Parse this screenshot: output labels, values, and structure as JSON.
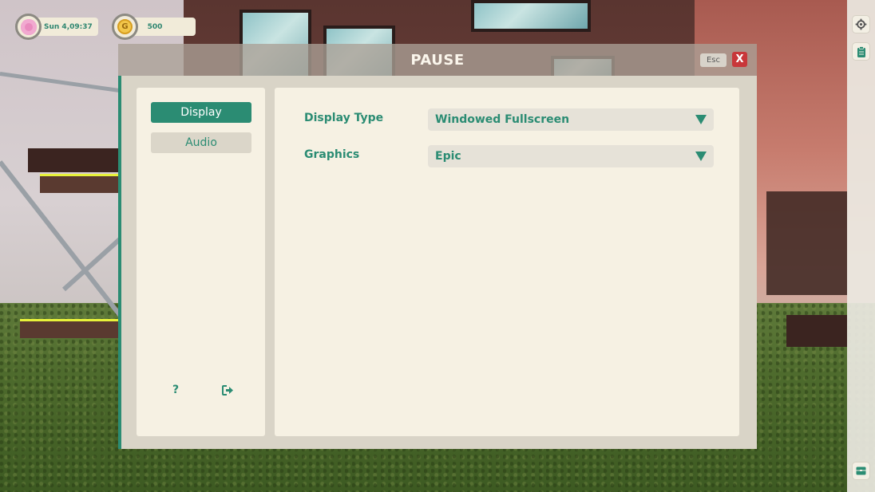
{
  "hud": {
    "time_text": "Sun 4,09:37",
    "time_icon": "flower-icon",
    "gold_symbol": "G",
    "gold_amount": "500",
    "gold_icon": "coin-icon"
  },
  "side_buttons": [
    "gear-icon",
    "clipboard-icon",
    "inventory-icon"
  ],
  "pause": {
    "title": "PAUSE",
    "esc_label": "Esc",
    "close_label": "X"
  },
  "tabs": [
    {
      "label": "Display",
      "active": true
    },
    {
      "label": "Audio",
      "active": false
    }
  ],
  "footer": {
    "help_label": "?",
    "exit_icon": "exit-icon"
  },
  "settings": [
    {
      "label": "Display Type",
      "value": "Windowed Fullscreen"
    },
    {
      "label": "Graphics",
      "value": "Epic"
    }
  ],
  "colors": {
    "accent": "#2b8c73",
    "close_button": "#c8373a",
    "panel_bg": "#d9d4c7",
    "card_bg": "#f6f1e3"
  }
}
